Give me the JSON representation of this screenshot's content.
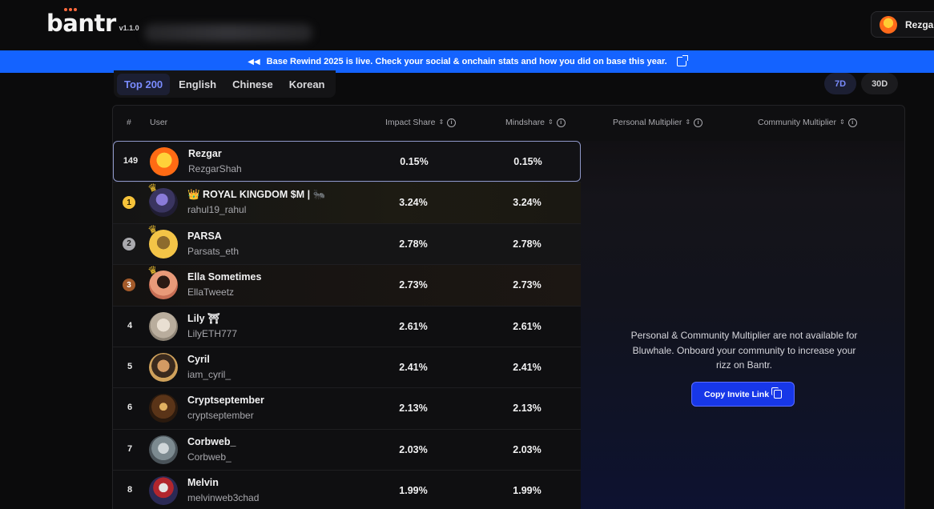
{
  "header": {
    "logo": "bantr",
    "version": "v1.1.0",
    "profile_name": "Rezgar"
  },
  "banner": {
    "icon": "rewind-icon",
    "text": "Base Rewind 2025 is live. Check your social & onchain stats and how you did on base this year."
  },
  "tabs": [
    "Top 200",
    "English",
    "Chinese",
    "Korean"
  ],
  "range_tabs": [
    "7D",
    "30D"
  ],
  "table": {
    "columns": {
      "rank": "#",
      "user": "User",
      "impact": "Impact Share",
      "mindshare": "Mindshare",
      "personal": "Personal Multiplier",
      "community": "Community Multiplier"
    },
    "rows": [
      {
        "rank": "149",
        "name": "Rezgar",
        "handle": "RezgarShah",
        "impact": "0.15%",
        "mindshare": "0.15%"
      },
      {
        "rank": "1",
        "name": "👑 ROYAL KINGDOM $M | 🐜",
        "handle": "rahul19_rahul",
        "impact": "3.24%",
        "mindshare": "3.24%"
      },
      {
        "rank": "2",
        "name": "PARSA",
        "handle": "Parsats_eth",
        "impact": "2.78%",
        "mindshare": "2.78%"
      },
      {
        "rank": "3",
        "name": "Ella Sometimes",
        "handle": "EllaTweetz",
        "impact": "2.73%",
        "mindshare": "2.73%"
      },
      {
        "rank": "4",
        "name": "Lily ⛩",
        "handle": "LilyETH777",
        "impact": "2.61%",
        "mindshare": "2.61%"
      },
      {
        "rank": "5",
        "name": "Cyril",
        "handle": "iam_cyril_",
        "impact": "2.41%",
        "mindshare": "2.41%"
      },
      {
        "rank": "6",
        "name": "Cryptseptember",
        "handle": "cryptseptember",
        "impact": "2.13%",
        "mindshare": "2.13%"
      },
      {
        "rank": "7",
        "name": "Corbweb_",
        "handle": "Corbweb_",
        "impact": "2.03%",
        "mindshare": "2.03%"
      },
      {
        "rank": "8",
        "name": "Melvin",
        "handle": "melvinweb3chad",
        "impact": "1.99%",
        "mindshare": "1.99%"
      }
    ]
  },
  "overlay": {
    "message": "Personal & Community Multiplier are not available for Bluwhale. Onboard your community to increase your rizz on Bantr.",
    "button": "Copy Invite Link"
  }
}
